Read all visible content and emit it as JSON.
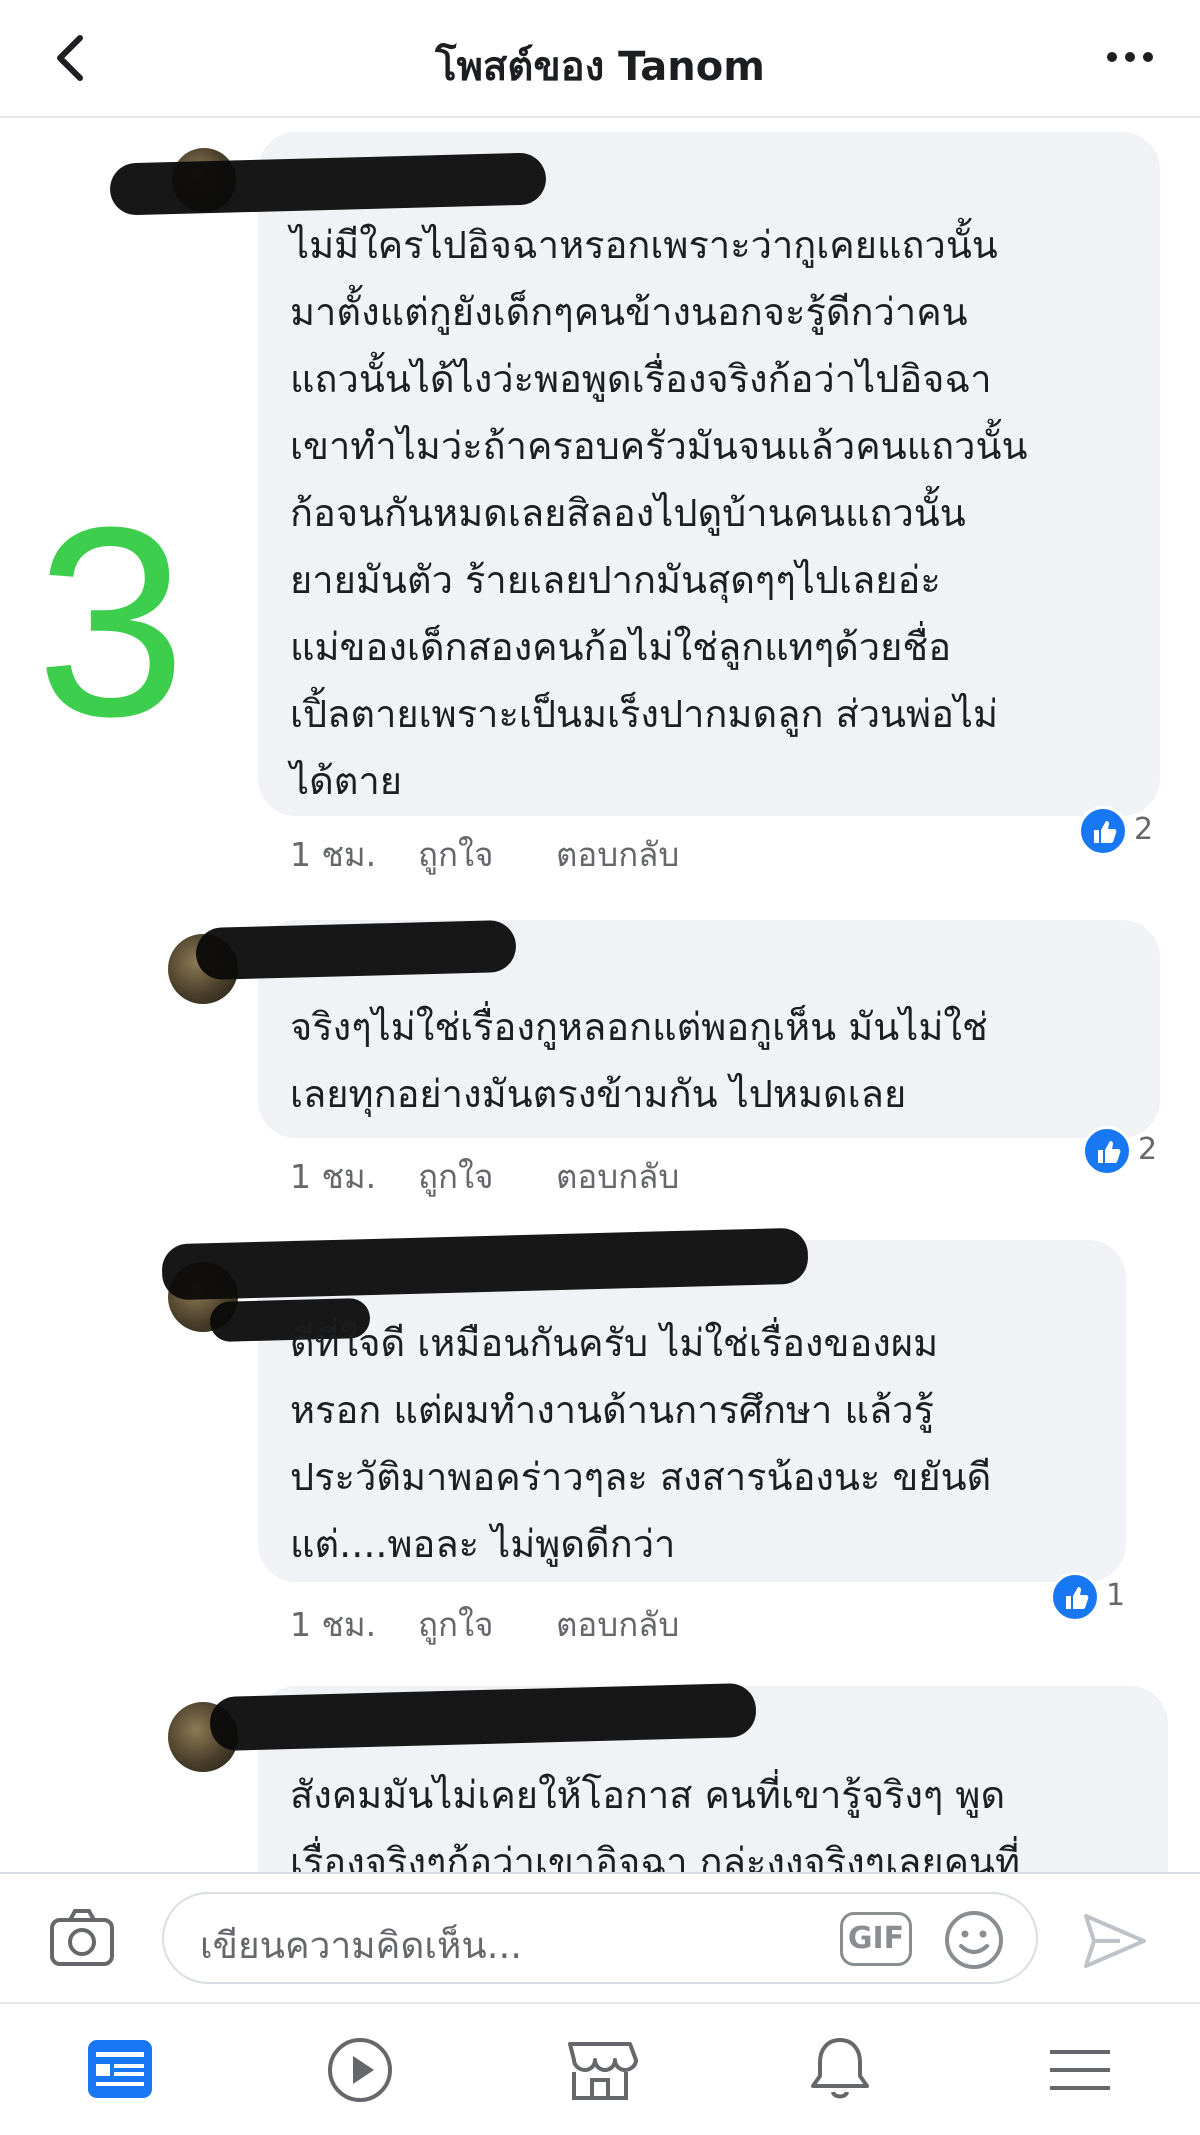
{
  "header": {
    "title": "โพสต์ของ Tanom"
  },
  "overlay_number": "3",
  "comments": [
    {
      "text": "ไม่มีใครไปอิจฉาหรอกเพราะว่ากูเคยแถวนั้น\nมาตั้งแต่กูยังเด็กๆคนข้างนอกจะรู้ดีกว่าคน\nแถวนั้นได้ไงว่ะพอพูดเรื่องจริงก้อว่าไปอิจฉา\nเขาทำไมว่ะถ้าครอบครัวมันจนแล้วคนแถวนั้น\nก้อจนกันหมดเลยสิลองไปดูบ้านคนแถวนั้น\nยายมันตัว ร้ายเลยปากมันสุดๆๆไปเลยอ่ะ\nแม่ของเด็กสองคนก้อไม่ใช่ลูกแทๆด้วยชื่อ\nเปิ้ลตายเพราะเป็นมเร็งปากมดลูก ส่วนพ่อไม่\nได้ตาย",
      "time": "1 ชม.",
      "like": "ถูกใจ",
      "reply": "ตอบกลับ",
      "reactions": "2"
    },
    {
      "text": "จริงๆไม่ใช่เรื่องกูหลอกแต่พอกูเห็น มันไม่ใช่\nเลยทุกอย่างมันตรงข้ามกัน ไปหมดเลย",
      "time": "1 ชม.",
      "like": "ถูกใจ",
      "reply": "ตอบกลับ",
      "reactions": "2"
    },
    {
      "text": "ดีที่ใจดี เหมือนกันครับ ไม่ใช่เรื่องของผม\nหรอก แต่ผมทำงานด้านการศึกษา แล้วรู้\nประวัติมาพอคร่าวๆละ สงสารน้องนะ ขยันดี\nแต่....พอละ ไม่พูดดีกว่า",
      "time": "1 ชม.",
      "like": "ถูกใจ",
      "reply": "ตอบกลับ",
      "reactions": "1"
    },
    {
      "text": "สังคมมันไม่เคยให้โอกาส คนที่เขารู้จริงๆ พูด\nเรื่องจริงๆก้อว่าเขาอิจฉา กล่ะงงจริงๆเลยคนที่"
    }
  ],
  "composer": {
    "placeholder": "เขียนความคิดเห็น...",
    "gif_label": "GIF"
  },
  "colors": {
    "accent": "#1877f2",
    "bubble": "#f0f2f5",
    "overlay_number": "#3ece4e"
  },
  "icons": {
    "header": [
      "back-arrow-icon",
      "more-dots-icon"
    ],
    "composer": [
      "camera-icon",
      "gif-icon",
      "emoji-icon",
      "send-icon"
    ],
    "tabbar": [
      "news-feed-icon",
      "watch-play-icon",
      "marketplace-icon",
      "notifications-bell-icon",
      "menu-icon"
    ]
  }
}
